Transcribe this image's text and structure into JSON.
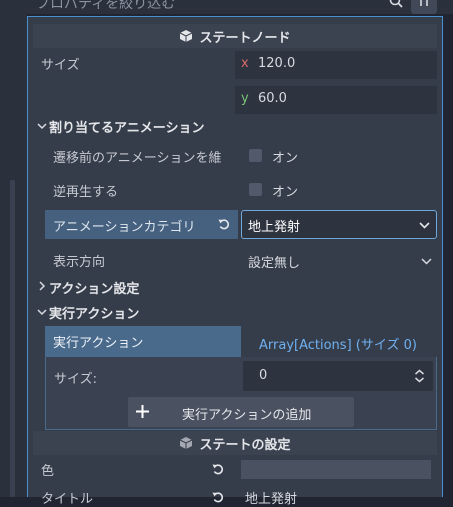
{
  "filter": {
    "placeholder": "プロパティを絞り込む"
  },
  "state_node": {
    "header": "ステートノード",
    "size_label": "サイズ",
    "size_x_axis": "x",
    "size_x_value": "120.0",
    "size_y_axis": "y",
    "size_y_value": "60.0"
  },
  "anim_section": {
    "header": "割り当てるアニメーション",
    "prev_anim_label": "遷移前のアニメーションを維",
    "prev_anim_check": "オン",
    "reverse_label": "逆再生する",
    "reverse_check": "オン",
    "category_label": "アニメーションカテゴリ",
    "category_value": "地上発射",
    "direction_label": "表示方向",
    "direction_value": "設定無し"
  },
  "action_settings": {
    "header": "アクション設定"
  },
  "exec_actions": {
    "header": "実行アクション",
    "row_label": "実行アクション",
    "row_value": "Array[Actions] (サイズ 0)",
    "size_label": "サイズ:",
    "size_value": "0",
    "add_button": "実行アクションの追加"
  },
  "state_settings": {
    "header": "ステートの設定",
    "color_label": "色",
    "title_label": "タイトル",
    "title_value": "地上発射"
  },
  "colors": {
    "accent": "#4a8fd0",
    "selected_row": "#46617f",
    "panel": "#363d4a"
  }
}
